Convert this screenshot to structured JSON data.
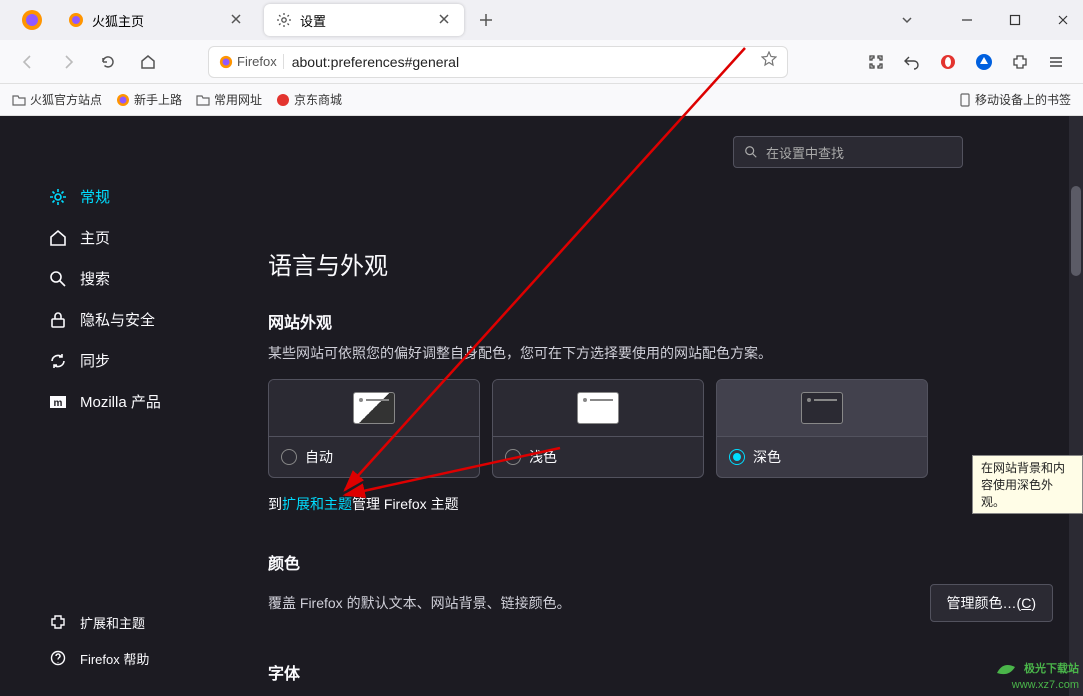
{
  "titlebar": {
    "tabs": [
      {
        "title": "火狐主页",
        "active": false
      },
      {
        "title": "设置",
        "active": true
      }
    ]
  },
  "urlbar": {
    "identity_label": "Firefox",
    "url": "about:preferences#general"
  },
  "bookmarks": {
    "items": [
      "火狐官方站点",
      "新手上路",
      "常用网址",
      "京东商城"
    ],
    "mobile": "移动设备上的书签"
  },
  "settings": {
    "search_placeholder": "在设置中查找",
    "sidebar": {
      "items": [
        {
          "id": "general",
          "label": "常规",
          "active": true
        },
        {
          "id": "home",
          "label": "主页"
        },
        {
          "id": "search",
          "label": "搜索"
        },
        {
          "id": "privacy",
          "label": "隐私与安全"
        },
        {
          "id": "sync",
          "label": "同步"
        },
        {
          "id": "mozilla",
          "label": "Mozilla 产品"
        }
      ],
      "bottom": [
        {
          "id": "extensions",
          "label": "扩展和主题"
        },
        {
          "id": "help",
          "label": "Firefox 帮助"
        }
      ]
    },
    "section_title": "语言与外观",
    "appearance": {
      "title": "网站外观",
      "desc": "某些网站可依照您的偏好调整自身配色，您可在下方选择要使用的网站配色方案。",
      "options": [
        {
          "id": "auto",
          "label": "自动"
        },
        {
          "id": "light",
          "label": "浅色"
        },
        {
          "id": "dark",
          "label": "深色",
          "selected": true
        }
      ],
      "tooltip": "在网站背景和内容使用深色外观。",
      "link_prefix": "到",
      "link_text": "扩展和主题",
      "link_suffix": "管理 Firefox 主题"
    },
    "colors": {
      "title": "颜色",
      "desc": "覆盖 Firefox 的默认文本、网站背景、链接颜色。",
      "button": "管理颜色…(C)",
      "button_prefix": "管理颜色…(",
      "button_key": "C",
      "button_suffix": ")"
    },
    "fonts": {
      "title": "字体"
    }
  },
  "watermark": {
    "brand": "极光下载站",
    "url": "www.xz7.com"
  }
}
